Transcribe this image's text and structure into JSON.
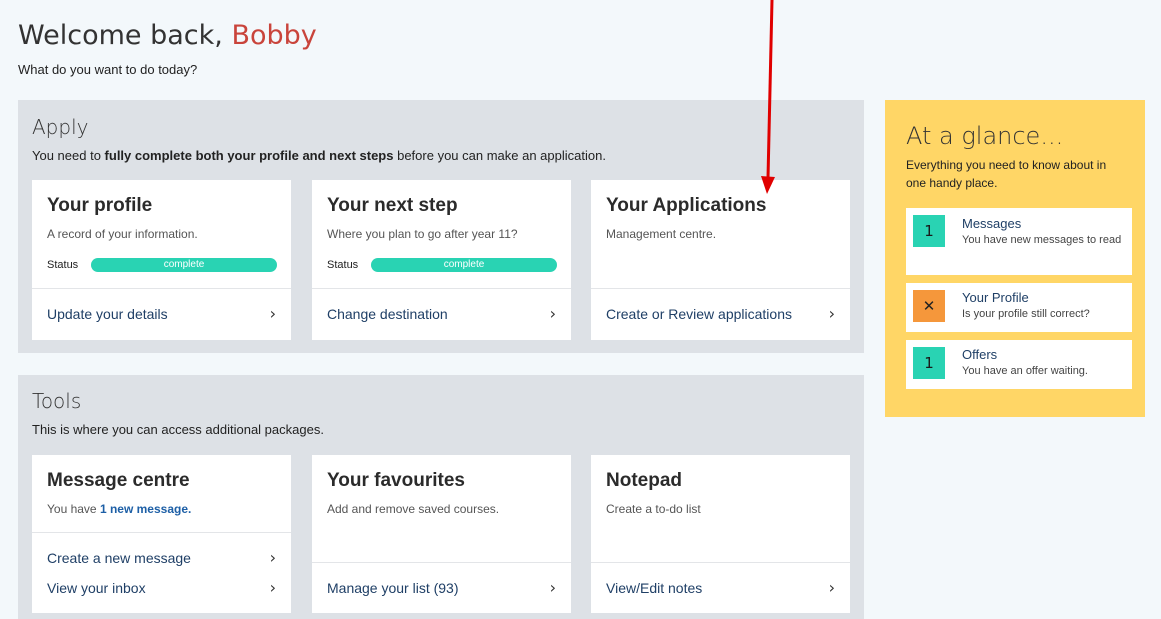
{
  "header": {
    "welcome_prefix": "Welcome back,",
    "user_name": "Bobby",
    "subtitle": "What do you want to do today?"
  },
  "apply": {
    "title": "Apply",
    "desc_before": "You need to ",
    "desc_bold": "fully complete both your profile and next steps",
    "desc_after": " before you can make an application.",
    "cards": [
      {
        "title": "Your profile",
        "subtitle": "A record of your information.",
        "status_label": "Status",
        "status_value": "complete",
        "link": "Update your details"
      },
      {
        "title": "Your next step",
        "subtitle": "Where you plan to go after year 11?",
        "status_label": "Status",
        "status_value": "complete",
        "link": "Change destination"
      },
      {
        "title": "Your Applications",
        "subtitle": "Management centre.",
        "link": "Create or Review applications"
      }
    ]
  },
  "tools": {
    "title": "Tools",
    "desc": "This is where you can access additional packages.",
    "cards": [
      {
        "title": "Message centre",
        "subtitle_before": "You have ",
        "subtitle_highlight": "1 new message.",
        "links": [
          "Create a new message",
          "View your inbox"
        ]
      },
      {
        "title": "Your favourites",
        "subtitle": "Add and remove saved courses.",
        "link": "Manage your list (93)"
      },
      {
        "title": "Notepad",
        "subtitle": "Create a to-do list",
        "link": "View/Edit notes"
      }
    ]
  },
  "glance": {
    "title": "At a glance...",
    "desc": "Everything you need to know about in one handy place.",
    "items": [
      {
        "badge": "1",
        "title": "Messages",
        "text": "You have new messages to read"
      },
      {
        "badge": "✕",
        "title": "Your Profile",
        "text": "Is your profile still correct?"
      },
      {
        "badge": "1",
        "title": "Offers",
        "text": "You have an offer waiting."
      }
    ]
  },
  "colors": {
    "accent_name": "#c9443b",
    "status_teal": "#29d3b3",
    "warning_orange": "#f5973b",
    "glance_yellow": "#ffd666",
    "annotation_arrow": "#e00000"
  },
  "icons": {
    "link_chevron": "chevron-right-icon",
    "profile_warning": "cross-icon"
  }
}
